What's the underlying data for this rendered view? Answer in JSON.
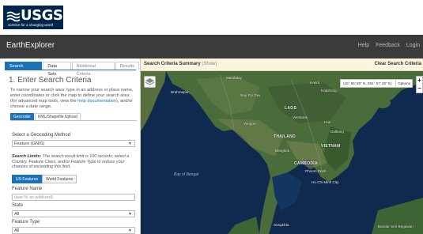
{
  "brand": {
    "name": "USGS",
    "tagline": "science for a changing world"
  },
  "app": {
    "title": "EarthExplorer",
    "links": [
      "Help",
      "Feedback",
      "Login"
    ]
  },
  "tabs": [
    {
      "label": "Search Criteria",
      "active": true
    },
    {
      "label": "Data Sets",
      "active": false
    },
    {
      "label": "Additional Criteria",
      "active": false
    },
    {
      "label": "Results",
      "active": false
    }
  ],
  "criteria": {
    "title": "1. Enter Search Criteria",
    "intro_before_link": "To narrow your search area: type in an address or place name, enter coordinates or click the map to define your search area (for advanced map tools, view the ",
    "intro_link": "help documentation",
    "intro_after_link": "), and/or choose a date range.",
    "subtabs": [
      {
        "label": "Geocoder",
        "active": true
      },
      {
        "label": "KML/Shapefile Upload",
        "active": false
      }
    ],
    "geocoding_method_label": "Select a Geocoding Method",
    "geocoding_method_value": "Feature (GNIS)",
    "search_limits_title": "Search Limits:",
    "search_limits_text": " The search result limit is 100 records; select a Country, Feature Class, and/or Feature Type to reduce your chances of exceeding this limit.",
    "feature_buttons": [
      {
        "label": "US Features",
        "active": true
      },
      {
        "label": "World Features",
        "active": false
      }
    ],
    "feature_name_label": "Feature Name",
    "feature_name_placeholder": "(use % as wildcard)",
    "state_label": "State",
    "state_value": "All",
    "feature_type_label": "Feature Type",
    "feature_type_value": "All"
  },
  "map_header": {
    "title": "Search Criteria Summary",
    "show": "(Show)",
    "clear": "Clear Search Criteria"
  },
  "map": {
    "coordinates": "(15° 55' 80\" N, 091° 57' 20\" E)",
    "options_label": "Options",
    "zoom_in": "+",
    "zoom_out": "−",
    "labels": [
      {
        "text": "Mandalay",
        "kind": "city"
      },
      {
        "text": "Hanoi",
        "kind": "city"
      },
      {
        "text": "Haiphong",
        "kind": "city"
      },
      {
        "text": "Nay Pyi Taw",
        "kind": "city"
      },
      {
        "text": "Brahmapur",
        "kind": "city"
      },
      {
        "text": "LAOS",
        "kind": "country"
      },
      {
        "text": "Vientiane",
        "kind": "city"
      },
      {
        "text": "Yangon",
        "kind": "city"
      },
      {
        "text": "Hue",
        "kind": "city"
      },
      {
        "text": "Dalkang",
        "kind": "city"
      },
      {
        "text": "THAILAND",
        "kind": "country"
      },
      {
        "text": "VIETNAM",
        "kind": "country"
      },
      {
        "text": "Bangkok",
        "kind": "city"
      },
      {
        "text": "CAMBODIA",
        "kind": "country"
      },
      {
        "text": "Phnom Penh",
        "kind": "city"
      },
      {
        "text": "Ho Chi Minh City",
        "kind": "city"
      },
      {
        "text": "Bay of Bengal",
        "kind": "sea"
      },
      {
        "text": "Songkhla",
        "kind": "city"
      },
      {
        "text": "Bandar Seri Begawan",
        "kind": "city"
      }
    ]
  },
  "colors": {
    "brand_navy": "#00264c",
    "app_bar": "#3b3b3b",
    "accent_blue": "#1c72b8",
    "summary_bar": "#fcf4df",
    "sea": "#0f2a4e",
    "land": "#4a6b3a"
  },
  "icons": [
    "usgs-wave-icon",
    "layers-icon",
    "chevron-down-icon"
  ]
}
